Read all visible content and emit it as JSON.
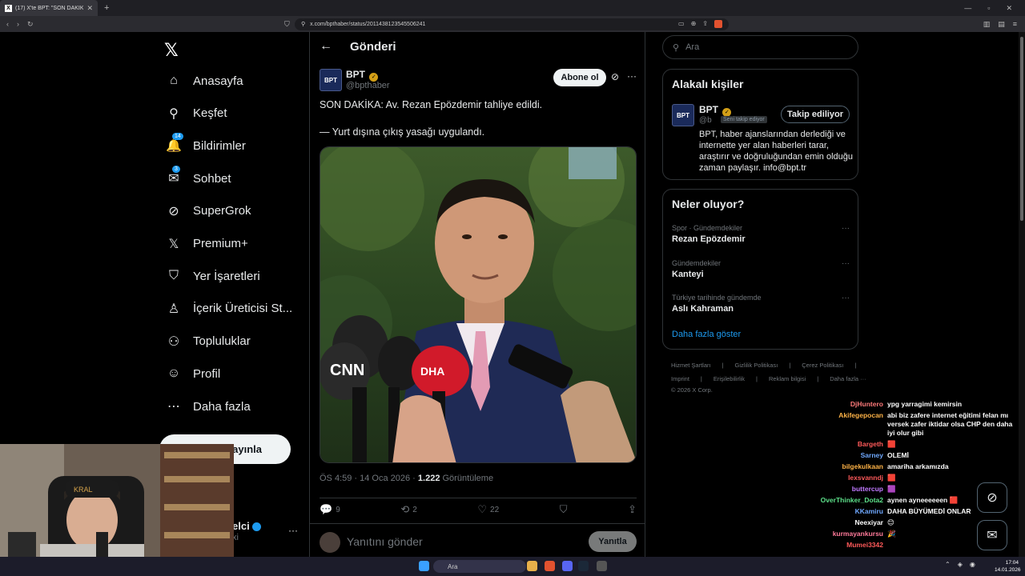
{
  "browser": {
    "tab_title": "(17) X'te BPT: \"SON DAKİKA: Av.",
    "url": "x.com/bpthaber/status/2011438123545506241"
  },
  "nav": {
    "items": [
      {
        "label": "Anasayfa",
        "icon": "home-icon"
      },
      {
        "label": "Keşfet",
        "icon": "search-icon"
      },
      {
        "label": "Bildirimler",
        "icon": "bell-icon",
        "badge": "14"
      },
      {
        "label": "Sohbet",
        "icon": "mail-icon",
        "badge": "3"
      },
      {
        "label": "SuperGrok",
        "icon": "grok-icon"
      },
      {
        "label": "Premium+",
        "icon": "x-icon"
      },
      {
        "label": "Yer İşaretleri",
        "icon": "bookmark-icon"
      },
      {
        "label": "İçerik Üreticisi St...",
        "icon": "creator-icon"
      },
      {
        "label": "Topluluklar",
        "icon": "communities-icon"
      },
      {
        "label": "Profil",
        "icon": "profile-icon"
      },
      {
        "label": "Daha fazla",
        "icon": "more-icon"
      }
    ],
    "post_button": "ayınla",
    "account_name": "elci",
    "account_sub": "xi"
  },
  "post": {
    "header_title": "Gönderi",
    "author_name": "BPT",
    "author_handle": "@bpthaber",
    "avatar_text": "BPT",
    "subscribe_label": "Abone ol",
    "line1": "SON DAKİKA: Av. Rezan Epözdemir tahliye edildi.",
    "line2": "— Yurt dışına çıkış yasağı uygulandı.",
    "time": "ÖS 4:59 · 14 Oca 2026 · ",
    "views": "1.222",
    "views_label": " Görüntüleme",
    "replies": "9",
    "reposts": "2",
    "likes": "22",
    "reply_placeholder": "Yanıtını gönder",
    "reply_button": "Yanıtla"
  },
  "sidebar": {
    "search_placeholder": "Ara",
    "related_title": "Alakalı kişiler",
    "related": {
      "name": "BPT",
      "handle": "@b",
      "tag": "Seni takip ediyor",
      "follow_label": "Takip ediliyor",
      "bio": "BPT, haber ajanslarından derlediği ve internette yer alan haberleri tarar, araştırır ve doğruluğundan emin olduğu zaman paylaşır. info@bpt.tr"
    },
    "trends_title": "Neler oluyor?",
    "trends": [
      {
        "category": "Spor · Gündemdekiler",
        "name": "Rezan Epözdemir"
      },
      {
        "category": "Gündemdekiler",
        "name": "Kanteyi"
      },
      {
        "category": "Türkiye tarihinde gündemde",
        "name": "Aslı Kahraman"
      }
    ],
    "show_more": "Daha fazla göster",
    "footer_row1": [
      "Hizmet Şartları",
      "|",
      "Gizlilik Politikası",
      "|",
      "Çerez Politikası",
      "|"
    ],
    "footer_row2": [
      "Imprint",
      "|",
      "Erişilebilirlik",
      "|",
      "Reklam bilgisi",
      "|",
      "Daha fazla ···"
    ],
    "footer_row3": "© 2026 X Corp."
  },
  "chat": [
    {
      "user": "DjHuntero",
      "msg": "ypg yarragimi kemirsin",
      "color": "#ff7a7a"
    },
    {
      "user": "Akifegepocan",
      "msg": "abi biz zafere internet eğitimi felan mı versek zafer iktidar olsa CHP den daha iyi olur gibi",
      "color": "#ffb347"
    },
    {
      "user": "Bargeth",
      "msg": "🟥",
      "color": "#ff5a5a"
    },
    {
      "user": "Sarney",
      "msg": "OLEMİ",
      "color": "#6fa8ff"
    },
    {
      "user": "bilgekulkaan",
      "msg": "amariha arkamızda",
      "color": "#ffb347"
    },
    {
      "user": "lexsvanndj",
      "msg": "🟥",
      "color": "#ff5a5a"
    },
    {
      "user": "buttercup",
      "msg": "🟪",
      "color": "#c07aff"
    },
    {
      "user": "OverThinker_Dota2",
      "msg": "aynen ayneeeeeen 🟥",
      "color": "#5de08a"
    },
    {
      "user": "KKamiru",
      "msg": "DAHA BÜYÜMEDİ ONLAR",
      "color": "#6fa8ff"
    },
    {
      "user": "Neexiyar",
      "msg": "😊",
      "color": "#ffffff"
    },
    {
      "user": "kurmayankursu",
      "msg": "🎉",
      "color": "#ff7a9a"
    },
    {
      "user": "Mumei3342",
      "msg": "",
      "color": "#ff5a5a"
    }
  ],
  "taskbar": {
    "search": "Ara",
    "time": "17:04",
    "date": "14.01.2026"
  }
}
